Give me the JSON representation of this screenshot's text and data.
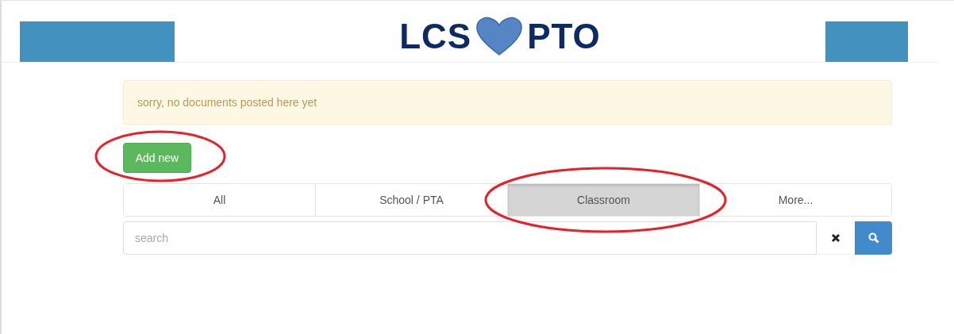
{
  "header": {
    "logo_left": "LCS",
    "logo_right": "PTO"
  },
  "alert": {
    "text": "sorry, no documents posted here yet"
  },
  "add_button": {
    "label": "Add new",
    "circled": true
  },
  "tabs": [
    {
      "label": "All",
      "selected": false,
      "circled": false
    },
    {
      "label": "School / PTA",
      "selected": false,
      "circled": false
    },
    {
      "label": "Classroom",
      "selected": true,
      "circled": true
    },
    {
      "label": "More...",
      "selected": false,
      "circled": false
    }
  ],
  "search": {
    "placeholder": "search"
  }
}
